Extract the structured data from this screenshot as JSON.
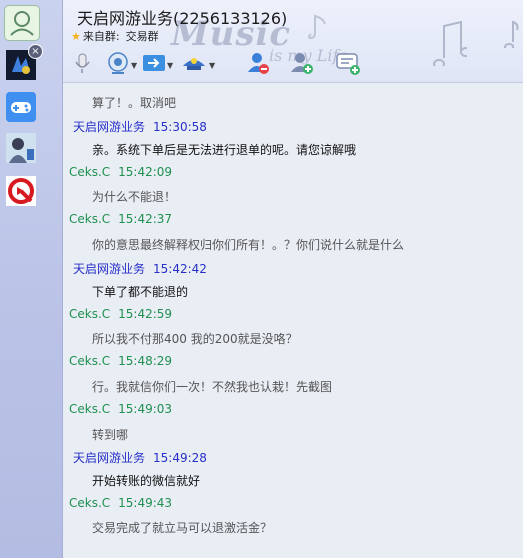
{
  "window": {
    "title": "天启网游业务(2256133126)",
    "group_prefix": "来自群:",
    "group_name": "交易群",
    "decoration_text_main": "Music",
    "decoration_text_sub": "is my Life"
  },
  "sidebar": {
    "items": [
      {
        "icon": "contact-avatar-icon",
        "active": true
      },
      {
        "icon": "game-avatar-icon",
        "active": false
      },
      {
        "icon": "gamepad-icon",
        "active": false
      },
      {
        "icon": "person-avatar-icon",
        "active": false
      },
      {
        "icon": "q-logo-icon",
        "active": false
      }
    ],
    "close_glyph": "×"
  },
  "toolbar": {
    "items": [
      "microphone-icon",
      "video-camera-icon",
      "send-file-icon",
      "remote-assist-icon",
      "contacts-icon",
      "add-friend-icon",
      "new-message-icon"
    ]
  },
  "messages": [
    {
      "sender": "",
      "time": "",
      "text": "算了！。取消吧",
      "style": "self"
    },
    {
      "sender": "天启网游业务",
      "time": "15:30:58",
      "text": "亲。系统下单后是无法进行退单的呢。请您谅解哦",
      "style": "other"
    },
    {
      "sender": "Ceks.C",
      "time": "15:42:09",
      "text": "为什么不能退！",
      "style": "self"
    },
    {
      "sender": "Ceks.C",
      "time": "15:42:37",
      "text": "你的意思最终解释权归你们所有！。？你们说什么就是什么",
      "style": "self"
    },
    {
      "sender": "天启网游业务",
      "time": "15:42:42",
      "text": "下单了都不能退的",
      "style": "other"
    },
    {
      "sender": "Ceks.C",
      "time": "15:42:59",
      "text": "所以我不付那400   我的200就是没咯？",
      "style": "self"
    },
    {
      "sender": "Ceks.C",
      "time": "15:48:29",
      "text": "行。我就信你们一次！不然我也认栽！先截图",
      "style": "self"
    },
    {
      "sender": "Ceks.C",
      "time": "15:49:03",
      "text": "转到哪",
      "style": "self"
    },
    {
      "sender": "天启网游业务",
      "time": "15:49:28",
      "text": "开始转账的微信就好",
      "style": "other"
    },
    {
      "sender": "Ceks.C",
      "time": "15:49:43",
      "text": "交易完成了就立马可以退激活金？",
      "style": "self"
    }
  ],
  "colors": {
    "self_sender": "#1e9050",
    "other_sender": "#2730c9",
    "background": "#e9edf4"
  }
}
